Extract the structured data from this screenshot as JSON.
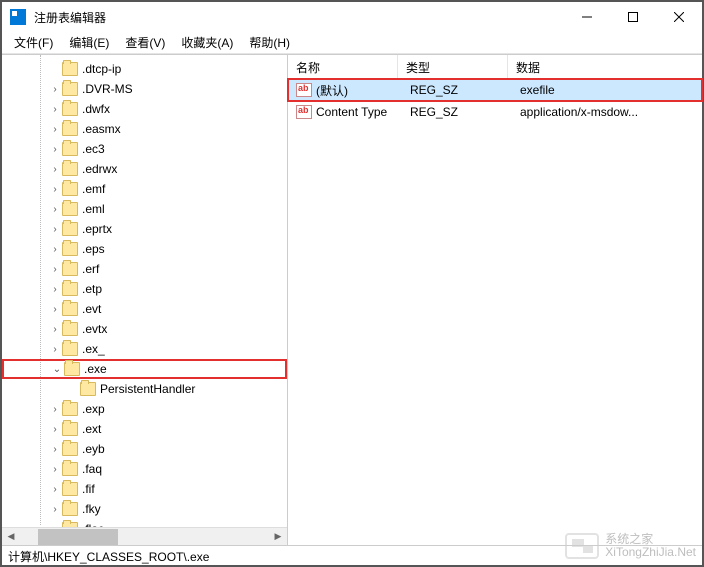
{
  "window": {
    "title": "注册表编辑器"
  },
  "menu": {
    "file": "文件(F)",
    "edit": "编辑(E)",
    "view": "查看(V)",
    "favorites": "收藏夹(A)",
    "help": "帮助(H)"
  },
  "tree": {
    "items": [
      {
        "label": ".dtcp-ip",
        "indent": 1,
        "expander": ""
      },
      {
        "label": ".DVR-MS",
        "indent": 1,
        "expander": ">"
      },
      {
        "label": ".dwfx",
        "indent": 1,
        "expander": ">"
      },
      {
        "label": ".easmx",
        "indent": 1,
        "expander": ">"
      },
      {
        "label": ".ec3",
        "indent": 1,
        "expander": ">"
      },
      {
        "label": ".edrwx",
        "indent": 1,
        "expander": ">"
      },
      {
        "label": ".emf",
        "indent": 1,
        "expander": ">"
      },
      {
        "label": ".eml",
        "indent": 1,
        "expander": ">"
      },
      {
        "label": ".eprtx",
        "indent": 1,
        "expander": ">"
      },
      {
        "label": ".eps",
        "indent": 1,
        "expander": ">"
      },
      {
        "label": ".erf",
        "indent": 1,
        "expander": ">"
      },
      {
        "label": ".etp",
        "indent": 1,
        "expander": ">"
      },
      {
        "label": ".evt",
        "indent": 1,
        "expander": ">"
      },
      {
        "label": ".evtx",
        "indent": 1,
        "expander": ">"
      },
      {
        "label": ".ex_",
        "indent": 1,
        "expander": ">"
      },
      {
        "label": ".exe",
        "indent": 1,
        "expander": "v",
        "highlight": true
      },
      {
        "label": "PersistentHandler",
        "indent": 2,
        "expander": ""
      },
      {
        "label": ".exp",
        "indent": 1,
        "expander": ">"
      },
      {
        "label": ".ext",
        "indent": 1,
        "expander": ">"
      },
      {
        "label": ".eyb",
        "indent": 1,
        "expander": ">"
      },
      {
        "label": ".faq",
        "indent": 1,
        "expander": ">"
      },
      {
        "label": ".fif",
        "indent": 1,
        "expander": ">"
      },
      {
        "label": ".fky",
        "indent": 1,
        "expander": ">"
      },
      {
        "label": ".flac",
        "indent": 1,
        "expander": ">"
      }
    ]
  },
  "list": {
    "headers": {
      "name": "名称",
      "type": "类型",
      "data": "数据"
    },
    "rows": [
      {
        "name": "(默认)",
        "type": "REG_SZ",
        "data": "exefile",
        "selected": true,
        "highlight": true
      },
      {
        "name": "Content Type",
        "type": "REG_SZ",
        "data": "application/x-msdow...",
        "selected": false
      }
    ]
  },
  "status": {
    "path": "计算机\\HKEY_CLASSES_ROOT\\.exe"
  },
  "watermark": {
    "line1": "系统之家",
    "line2": "XiTongZhiJia.Net"
  }
}
